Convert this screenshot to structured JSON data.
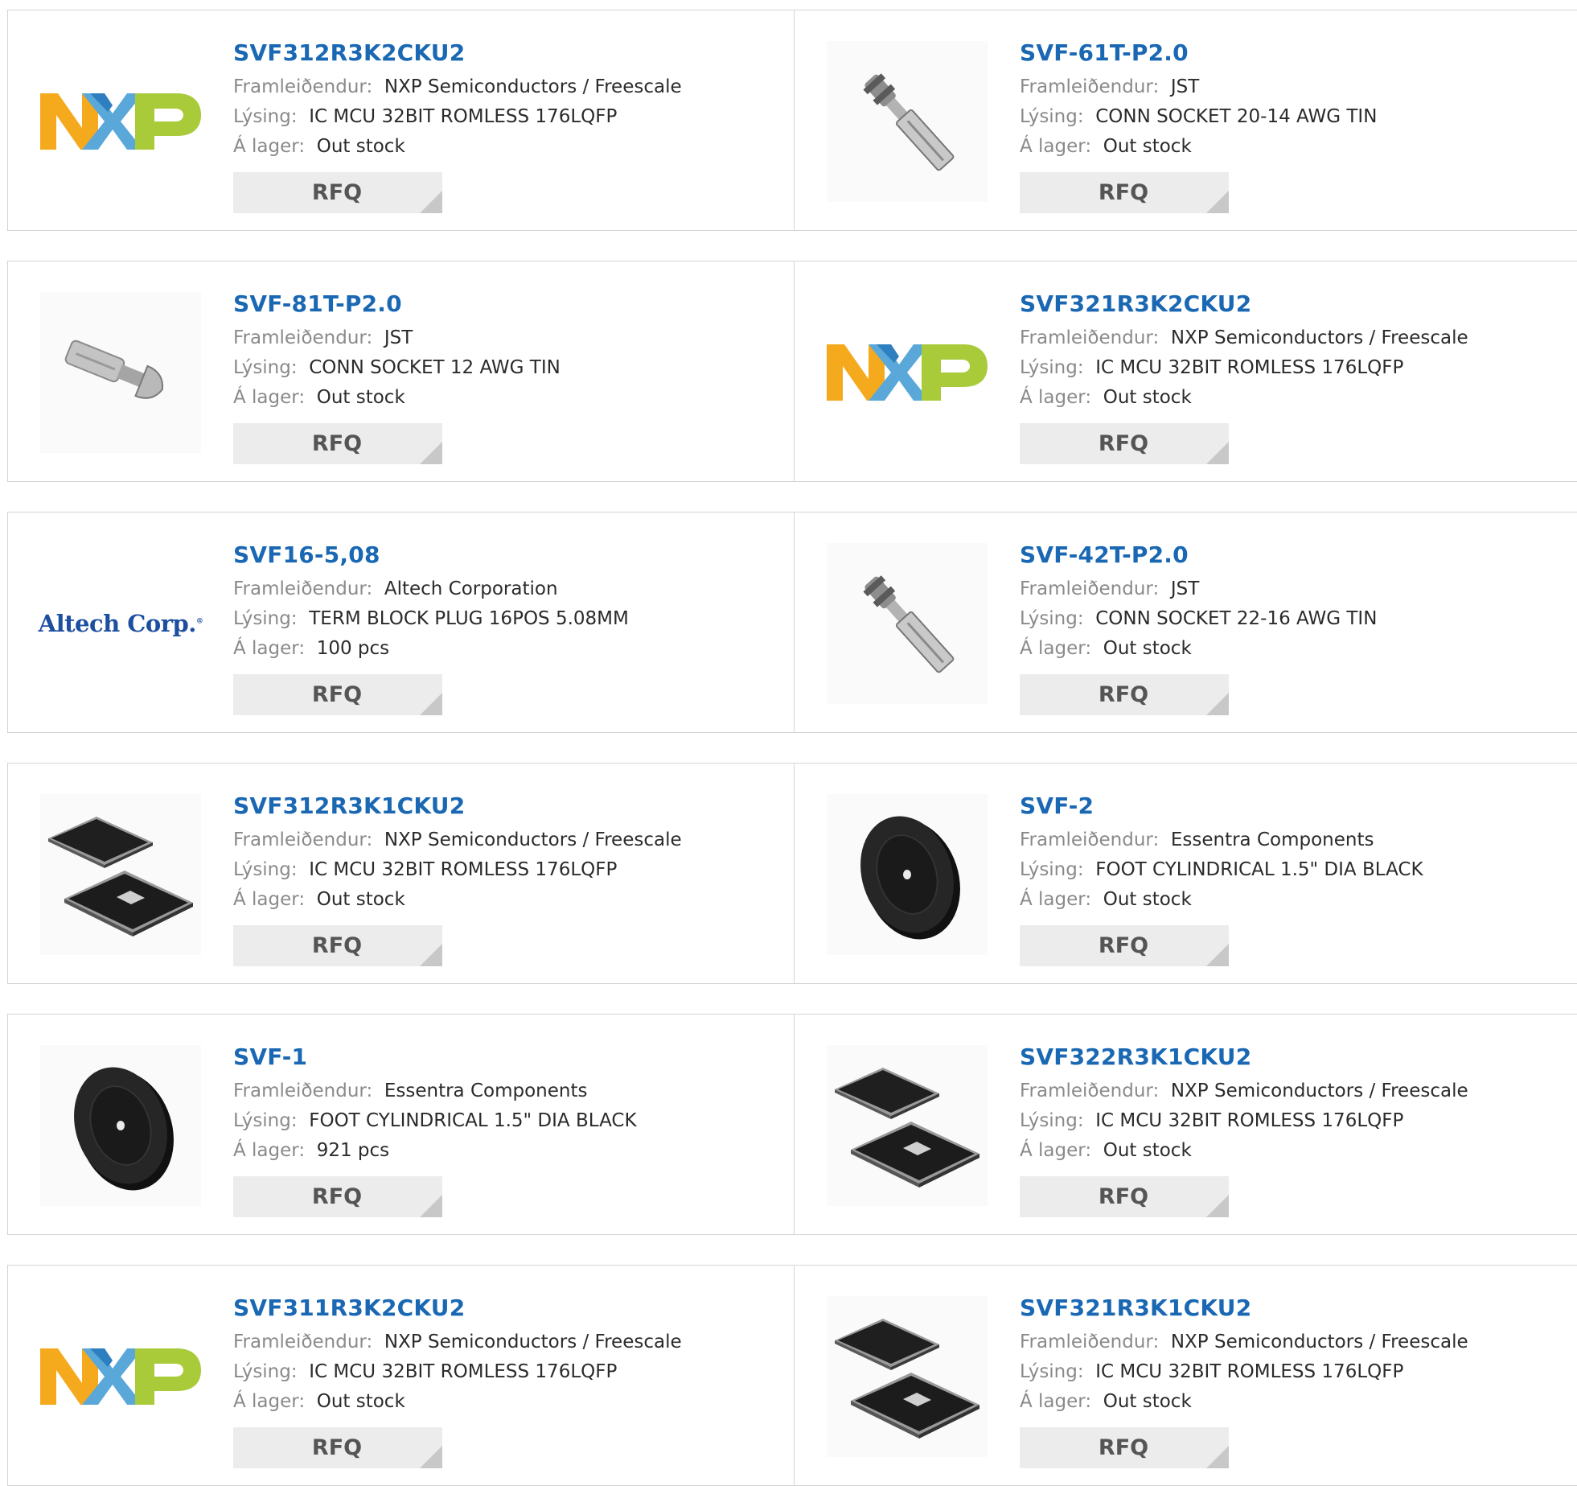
{
  "labels": {
    "manufacturer": "Framleiðendur:",
    "description": "Lýsing:",
    "stock": "Á lager:",
    "rfq": "RFQ"
  },
  "colors": {
    "title": "#1a68b3",
    "label": "#8a8a8a",
    "value": "#2b2b2b",
    "rfq_bg": "#ececec",
    "border": "#d4d4d4"
  },
  "products": [
    {
      "part": "SVF312R3K2CKU2",
      "manufacturer": "NXP Semiconductors / Freescale",
      "description": "IC MCU 32BIT ROMLESS 176LQFP",
      "stock": "Out stock",
      "image": "nxp-logo"
    },
    {
      "part": "SVF-61T-P2.0",
      "manufacturer": "JST",
      "description": "CONN SOCKET 20-14 AWG TIN",
      "stock": "Out stock",
      "image": "crimp-socket-long"
    },
    {
      "part": "SVF-81T-P2.0",
      "manufacturer": "JST",
      "description": "CONN SOCKET 12 AWG TIN",
      "stock": "Out stock",
      "image": "crimp-socket-short"
    },
    {
      "part": "SVF321R3K2CKU2",
      "manufacturer": "NXP Semiconductors / Freescale",
      "description": "IC MCU 32BIT ROMLESS 176LQFP",
      "stock": "Out stock",
      "image": "nxp-logo"
    },
    {
      "part": "SVF16-5,08",
      "manufacturer": "Altech Corporation",
      "description": "TERM BLOCK PLUG 16POS 5.08MM",
      "stock": "100 pcs",
      "image": "altech-logo",
      "logo_text": "Altech Corp."
    },
    {
      "part": "SVF-42T-P2.0",
      "manufacturer": "JST",
      "description": "CONN SOCKET 22-16 AWG TIN",
      "stock": "Out stock",
      "image": "crimp-socket-long"
    },
    {
      "part": "SVF312R3K1CKU2",
      "manufacturer": "NXP Semiconductors / Freescale",
      "description": "IC MCU 32BIT ROMLESS 176LQFP",
      "stock": "Out stock",
      "image": "lqfp-chip"
    },
    {
      "part": "SVF-2",
      "manufacturer": "Essentra Components",
      "description": "FOOT CYLINDRICAL 1.5\" DIA BLACK",
      "stock": "Out stock",
      "image": "rubber-foot"
    },
    {
      "part": "SVF-1",
      "manufacturer": "Essentra Components",
      "description": "FOOT CYLINDRICAL 1.5\" DIA BLACK",
      "stock": "921 pcs",
      "image": "rubber-foot"
    },
    {
      "part": "SVF322R3K1CKU2",
      "manufacturer": "NXP Semiconductors / Freescale",
      "description": "IC MCU 32BIT ROMLESS 176LQFP",
      "stock": "Out stock",
      "image": "lqfp-chip"
    },
    {
      "part": "SVF311R3K2CKU2",
      "manufacturer": "NXP Semiconductors / Freescale",
      "description": "IC MCU 32BIT ROMLESS 176LQFP",
      "stock": "Out stock",
      "image": "nxp-logo"
    },
    {
      "part": "SVF321R3K1CKU2",
      "manufacturer": "NXP Semiconductors / Freescale",
      "description": "IC MCU 32BIT ROMLESS 176LQFP",
      "stock": "Out stock",
      "image": "lqfp-chip"
    }
  ]
}
